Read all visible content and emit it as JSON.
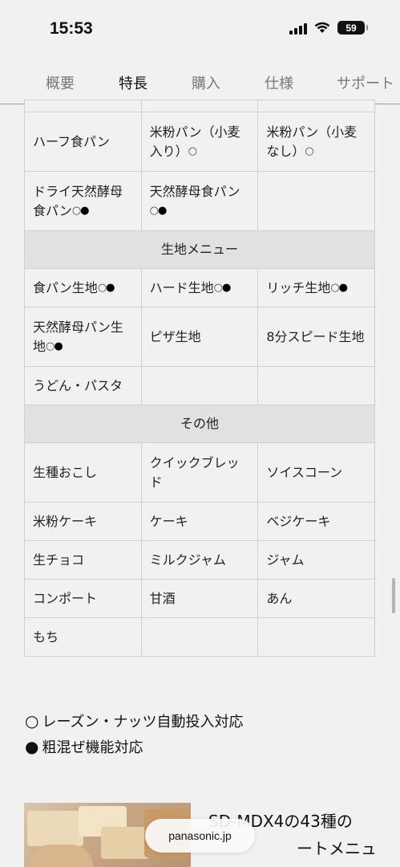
{
  "status": {
    "time": "15:53",
    "battery": "59"
  },
  "tabs": [
    {
      "label": "概要"
    },
    {
      "label": "特長",
      "active": true
    },
    {
      "label": "購入"
    },
    {
      "label": "仕様"
    },
    {
      "label": "サポート"
    }
  ],
  "table": {
    "rows1": [
      [
        "ハーフ食パン",
        "米粉パン（小麦入り）",
        "米粉パン（小麦なし）"
      ],
      [
        "ドライ天然酵母食パン",
        "天然酵母食パン",
        ""
      ]
    ],
    "section_dough": "生地メニュー",
    "rows2": [
      [
        "食パン生地",
        "ハード生地",
        "リッチ生地"
      ],
      [
        "天然酵母パン生地",
        "ピザ生地",
        "8分スピード生地"
      ],
      [
        "うどん・パスタ",
        "",
        ""
      ]
    ],
    "section_other": "その他",
    "rows3": [
      [
        "生種おこし",
        "クイックブレッド",
        "ソイスコーン"
      ],
      [
        "米粉ケーキ",
        "ケーキ",
        "ベジケーキ"
      ],
      [
        "生チョコ",
        "ミルクジャム",
        "ジャム"
      ],
      [
        "コンポート",
        "甘酒",
        "あん"
      ],
      [
        "もち",
        "",
        ""
      ]
    ],
    "mark_open": "○",
    "mark_fill": "●"
  },
  "legend": {
    "open_symbol": "○",
    "open_text": "レーズン・ナッツ自動投入対応",
    "fill_symbol": "●",
    "fill_text": "粗混ぜ機能対応"
  },
  "promo": {
    "title_line1": "SD-MDX4の43種の",
    "title_line2": "ートメニュー」"
  },
  "browser": {
    "url": "panasonic.jp"
  }
}
